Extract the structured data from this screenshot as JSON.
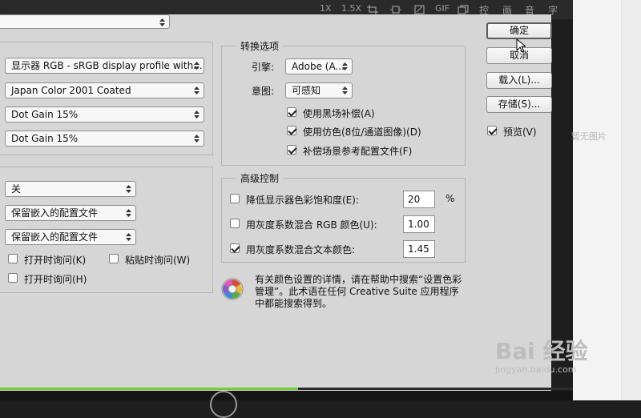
{
  "toolbar": {
    "items": [
      "1X",
      "1.5X",
      "",
      "",
      "",
      "GIF",
      "",
      "控",
      "画",
      "音",
      "字"
    ]
  },
  "side": {
    "no_image_text": "暂无图片"
  },
  "working_spaces": {
    "top_select": "",
    "rgb": "显示器 RGB - sRGB display profile with...",
    "cmyk": "Japan Color 2001 Coated",
    "gray": "Dot Gain 15%",
    "spot": "Dot Gain 15%"
  },
  "policies": {
    "rgb": "关",
    "cmyk": "保留嵌入的配置文件",
    "gray": "保留嵌入的配置文件",
    "cb_open_1": "打开时询问(K)",
    "cb_paste": "粘贴时询问(W)",
    "cb_open_2": "打开时询问(H)"
  },
  "conversion": {
    "title": "转换选项",
    "engine_label": "引擎:",
    "engine_value": "Adobe (A...",
    "intent_label": "意图:",
    "intent_value": "可感知",
    "cb_blackpoint": "使用黑场补偿(A)",
    "cb_dither": "使用仿色(8位/通道图像)(D)",
    "cb_compensate": "补偿场景参考配置文件(F)"
  },
  "advanced": {
    "title": "高级控制",
    "desat_label": "降低显示器色彩饱和度(E):",
    "desat_value": "20",
    "desat_unit": "%",
    "blend_rgb_label": "用灰度系数混合 RGB 颜色(U):",
    "blend_rgb_value": "1.00",
    "blend_text_label": "用灰度系数混合文本颜色:",
    "blend_text_value": "1.45"
  },
  "info": {
    "text": "有关颜色设置的详情，请在帮助中搜索“设置色彩管理”。此术语在任何 Creative Suite 应用程序中都能搜索得到。"
  },
  "buttons": {
    "ok": "确定",
    "cancel": "取消",
    "load": "载入(L)...",
    "save": "存储(S)...",
    "preview": "预览(V)"
  },
  "player": {
    "progress": 0.52
  },
  "watermark": {
    "main": "Bai 经验",
    "sub": "jingyan.baidu.com"
  }
}
